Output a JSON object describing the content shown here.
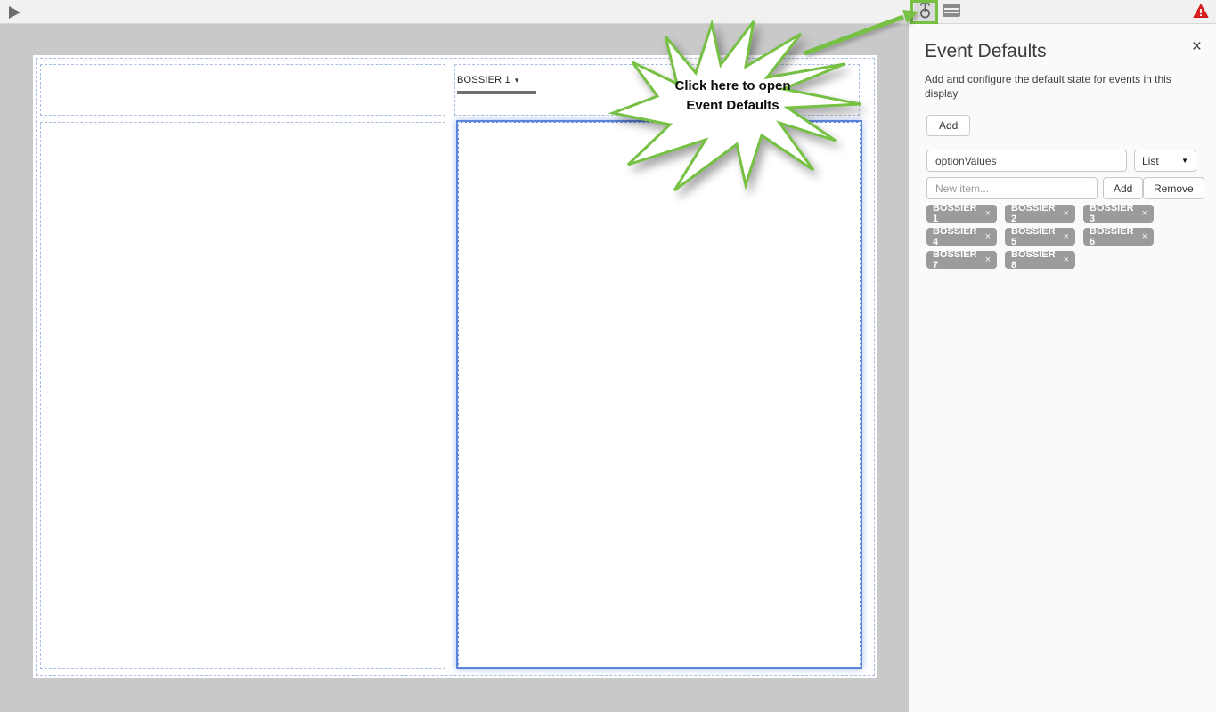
{
  "topbar": {
    "play_icon": "play",
    "event_defaults_icon": "event-defaults",
    "display_options_icon": "display-options",
    "warning_icon": "warning"
  },
  "canvas": {
    "event_dropdown": {
      "value": "BOSSIER 1"
    }
  },
  "annotation": {
    "line1": "Click here to open",
    "line2": "Event Defaults"
  },
  "panel": {
    "title": "Event Defaults",
    "description": "Add and configure the default state for events in this display",
    "add_button": "Add",
    "option_name_value": "optionValues",
    "type_select_value": "List",
    "new_item_placeholder": "New item...",
    "item_add_button": "Add",
    "item_remove_button": "Remove",
    "tags": [
      "BOSSIER 1",
      "BOSSIER 2",
      "BOSSIER 3",
      "BOSSIER 4",
      "BOSSIER 5",
      "BOSSIER 6",
      "BOSSIER 7",
      "BOSSIER 8"
    ]
  },
  "icons": {
    "close": "×",
    "caret_down": "▼",
    "dropdown_caret": "▾",
    "tag_remove": "×"
  },
  "colors": {
    "accent_green": "#76c043",
    "selection_blue": "#5b84da",
    "dashed_border": "#a9bedf",
    "tag_background": "#9b9b9b",
    "warning_red": "#dd1f1f",
    "toolbar_background": "#f1f1f1",
    "workspace_background": "#c9c9c9"
  }
}
